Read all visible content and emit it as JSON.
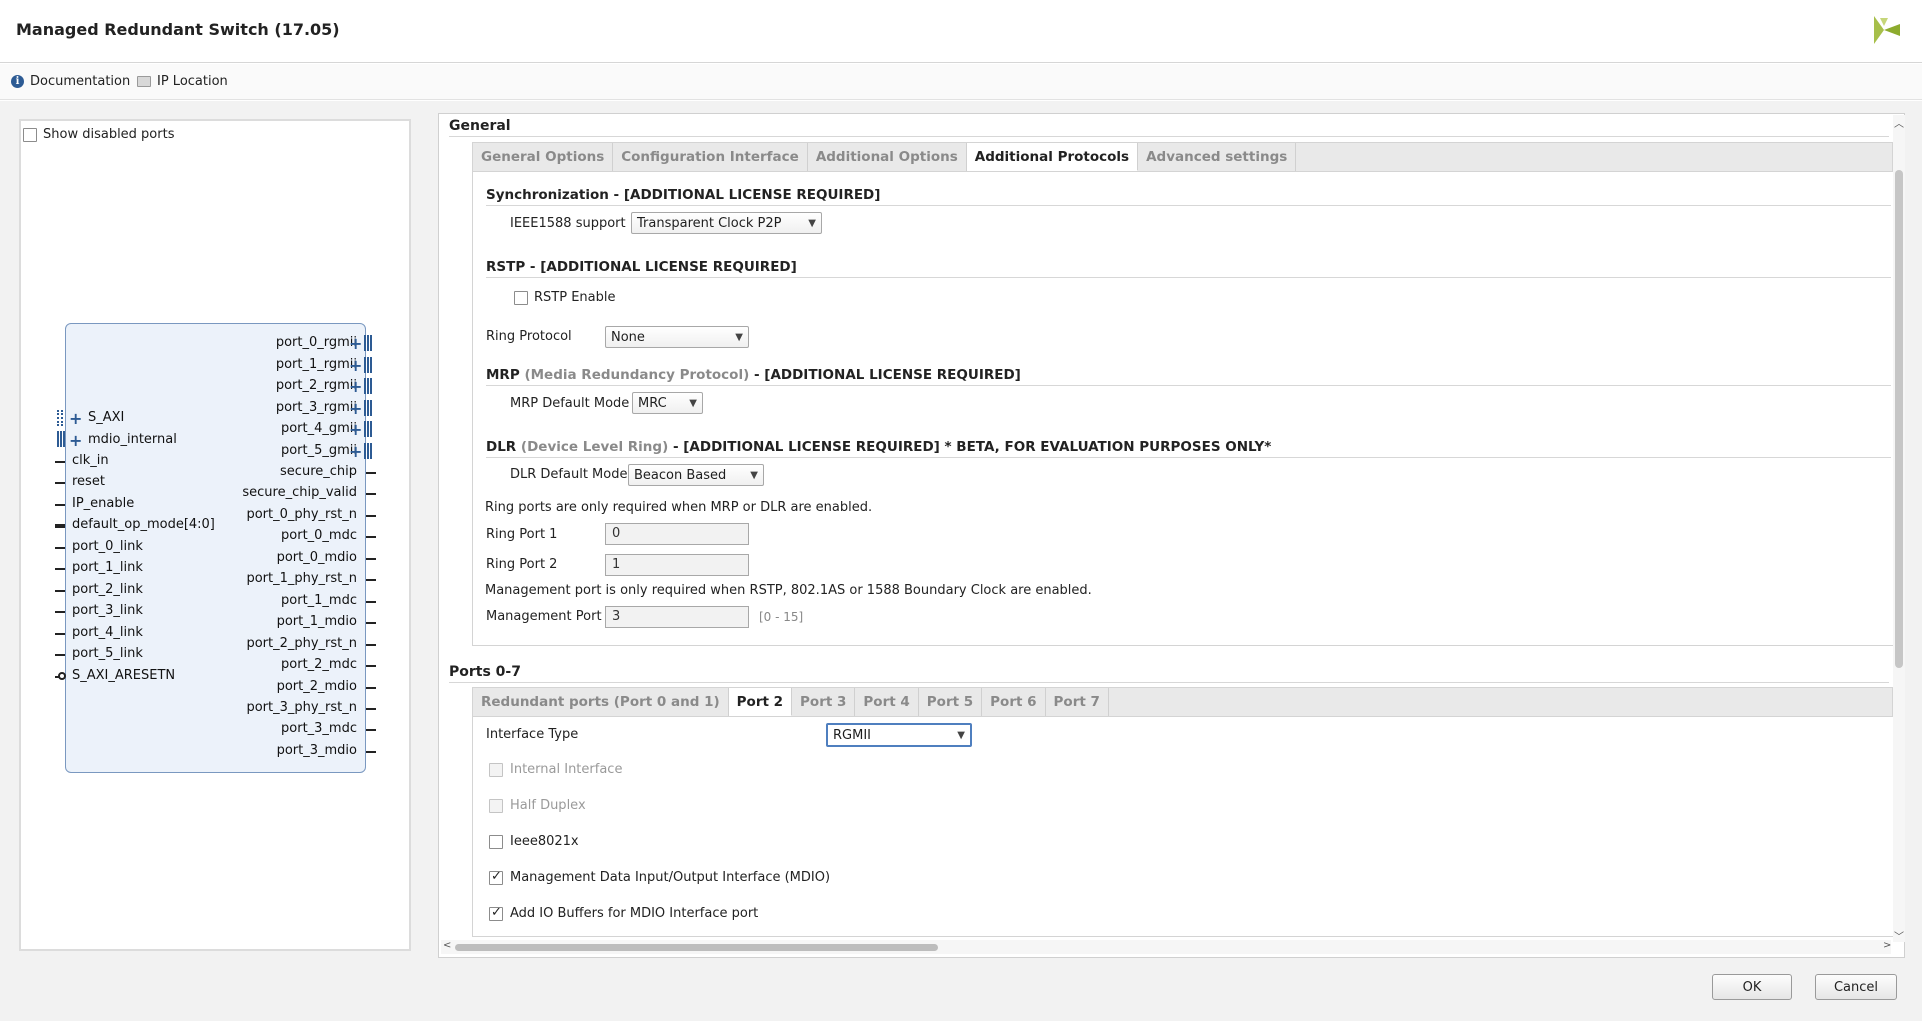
{
  "window": {
    "title": "Managed Redundant Switch (17.05)",
    "logo": "xilinx-logo"
  },
  "toolbar": {
    "documentation": "Documentation",
    "ip_location": "IP Location"
  },
  "symbol": {
    "show_disabled_ports": "Show disabled ports",
    "show_disabled_checked": false,
    "left_ports": {
      "s_axi": "S_AXI",
      "mdio_internal": "mdio_internal",
      "clk_in": "clk_in",
      "reset": "reset",
      "ip_enable": "IP_enable",
      "default_op_mode": "default_op_mode[4:0]",
      "port_0_link": "port_0_link",
      "port_1_link": "port_1_link",
      "port_2_link": "port_2_link",
      "port_3_link": "port_3_link",
      "port_4_link": "port_4_link",
      "port_5_link": "port_5_link",
      "s_axi_aresetn": "S_AXI_ARESETN"
    },
    "right_ports": {
      "port_0_rgmii": "port_0_rgmii",
      "port_1_rgmii": "port_1_rgmii",
      "port_2_rgmii": "port_2_rgmii",
      "port_3_rgmii": "port_3_rgmii",
      "port_4_gmii": "port_4_gmii",
      "port_5_gmii": "port_5_gmii",
      "secure_chip": "secure_chip",
      "secure_chip_valid": "secure_chip_valid",
      "port_0_phy_rst_n": "port_0_phy_rst_n",
      "port_0_mdc": "port_0_mdc",
      "port_0_mdio": "port_0_mdio",
      "port_1_phy_rst_n": "port_1_phy_rst_n",
      "port_1_mdc": "port_1_mdc",
      "port_1_mdio": "port_1_mdio",
      "port_2_phy_rst_n": "port_2_phy_rst_n",
      "port_2_mdc": "port_2_mdc",
      "port_2_mdio": "port_2_mdio",
      "port_3_phy_rst_n": "port_3_phy_rst_n",
      "port_3_mdc": "port_3_mdc",
      "port_3_mdio": "port_3_mdio"
    }
  },
  "general": {
    "title": "General",
    "tabs": {
      "general_options": "General Options",
      "configuration_interface": "Configuration Interface",
      "additional_options": "Additional Options",
      "additional_protocols": "Additional Protocols",
      "advanced_settings": "Advanced settings"
    },
    "active_tab": "Additional Protocols",
    "sync": {
      "title": "Synchronization - [ADDITIONAL LICENSE REQUIRED]",
      "ieee1588_label": "IEEE1588 support",
      "ieee1588_value": "Transparent Clock P2P"
    },
    "rstp": {
      "title": "RSTP - [ADDITIONAL LICENSE REQUIRED]",
      "enable_label": "RSTP Enable",
      "enable_checked": false,
      "ring_protocol_label": "Ring Protocol",
      "ring_protocol_value": "None"
    },
    "mrp": {
      "title_prefix": "MRP",
      "title_grey": "(Media Redundancy Protocol)",
      "title_suffix": "- [ADDITIONAL LICENSE REQUIRED]",
      "mode_label": "MRP Default Mode",
      "mode_value": "MRC"
    },
    "dlr": {
      "title_prefix": "DLR",
      "title_grey": "(Device Level Ring)",
      "title_suffix": "- [ADDITIONAL LICENSE REQUIRED] * BETA, FOR EVALUATION PURPOSES ONLY*",
      "mode_label": "DLR Default Mode",
      "mode_value": "Beacon Based"
    },
    "ring_note": "Ring ports are only required when MRP or DLR are enabled.",
    "ring_port_1_label": "Ring Port 1",
    "ring_port_1_value": "0",
    "ring_port_2_label": "Ring Port 2",
    "ring_port_2_value": "1",
    "mgmt_note": "Management port is only required when RSTP, 802.1AS or 1588 Boundary Clock are enabled.",
    "mgmt_port_label": "Management Port",
    "mgmt_port_value": "3",
    "mgmt_port_range": "[0 - 15]"
  },
  "ports": {
    "title": "Ports 0-7",
    "tabs": {
      "redundant": "Redundant ports (Port 0 and 1)",
      "port2": "Port 2",
      "port3": "Port 3",
      "port4": "Port 4",
      "port5": "Port 5",
      "port6": "Port 6",
      "port7": "Port 7"
    },
    "active_tab": "Port 2",
    "interface_type_label": "Interface Type",
    "interface_type_value": "RGMII",
    "internal_interface": "Internal Interface",
    "half_duplex": "Half Duplex",
    "ieee8021x": "Ieee8021x",
    "mdio": "Management Data Input/Output Interface (MDIO)",
    "io_buffers": "Add IO Buffers for MDIO Interface port",
    "checks": {
      "internal_interface": false,
      "half_duplex": false,
      "ieee8021x": false,
      "mdio": true,
      "io_buffers": true
    }
  },
  "buttons": {
    "ok": "OK",
    "cancel": "Cancel"
  },
  "colors": {
    "accent": "#2d5b94",
    "block_fill": "#ecf2fa",
    "logo": "#8dab2e"
  }
}
